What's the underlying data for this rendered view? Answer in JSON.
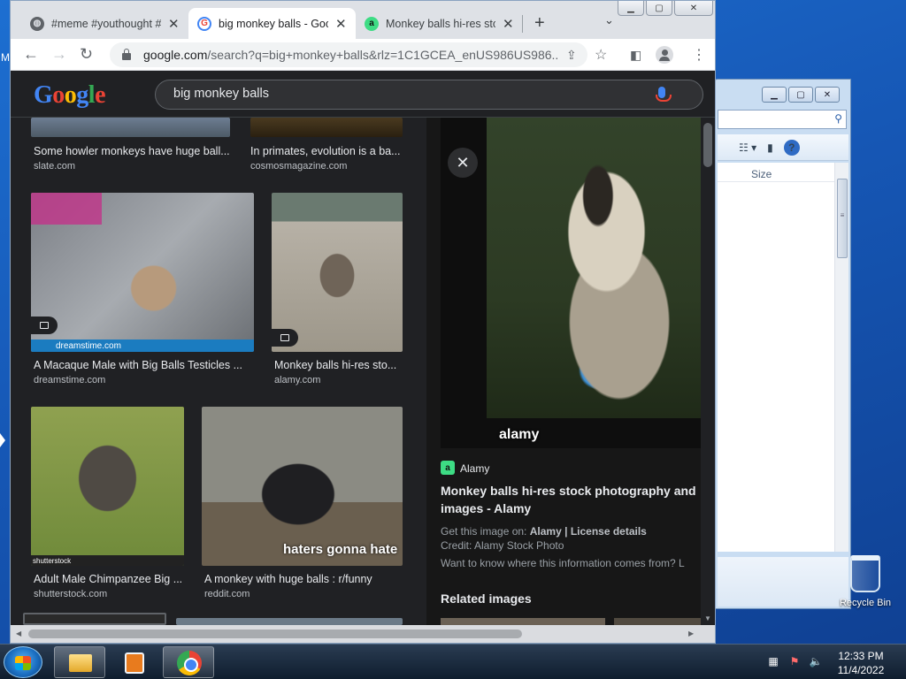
{
  "desktop": {
    "partial_text": "M",
    "recycle_bin_label": "Recycle Bin"
  },
  "explorer": {
    "column_size": "Size",
    "scroll_grip": "≡"
  },
  "browser": {
    "tabs": [
      {
        "title": "#meme #youthought #",
        "favicon": "globe-icon"
      },
      {
        "title": "big monkey balls - Goo",
        "favicon": "google-icon",
        "active": true
      },
      {
        "title": "Monkey balls hi-res sto",
        "favicon": "alamy-icon",
        "favicon_letter": "a"
      }
    ],
    "new_tab": "+",
    "tab_search": "⌄",
    "window": {
      "minimize": "▁",
      "maximize": "▢",
      "close": "✕"
    },
    "url": {
      "host": "google.com",
      "path": "/search?q=big+monkey+balls&rlz=1C1GCEA_enUS986US986..."
    }
  },
  "google": {
    "logo": [
      "G",
      "o",
      "o",
      "g",
      "l",
      "e"
    ],
    "query": "big monkey balls"
  },
  "results": [
    {
      "caption": "Some howler monkeys have huge ball...",
      "source": "slate.com"
    },
    {
      "caption": "In primates, evolution is a ba...",
      "source": "cosmosmagazine.com"
    },
    {
      "caption": "A Macaque Male with Big Balls Testicles ...",
      "source": "dreamstime.com",
      "watermark": "dreamstime.com"
    },
    {
      "caption": "Monkey balls hi-res sto...",
      "source": "alamy.com"
    },
    {
      "caption": "Adult Male Chimpanzee Big ...",
      "source": "shutterstock.com",
      "watermark": "shutterstock"
    },
    {
      "caption": "A monkey with huge balls : r/funny",
      "source": "reddit.com",
      "watermark": "haters gonna hate"
    }
  ],
  "preview": {
    "watermark": "alamy",
    "site_letter": "a",
    "site": "Alamy",
    "title": "Monkey balls hi-res stock photography and images - Alamy",
    "get_image_prefix": "Get this image on:",
    "get_image_site": "Alamy",
    "separator": "|",
    "license": "License details",
    "credit": "Credit: Alamy Stock Photo",
    "info": "Want to know where this information comes from? L",
    "related": "Related images"
  },
  "taskbar": {
    "time": "12:33 PM",
    "date": "11/4/2022"
  },
  "colors": {
    "page_bg": "#202124",
    "accent_blue": "#4285f4",
    "alamy_green": "#3ddc84"
  }
}
